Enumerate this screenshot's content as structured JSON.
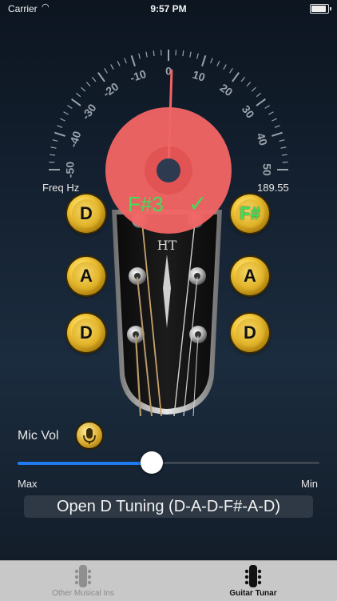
{
  "status_bar": {
    "carrier": "Carrier",
    "time": "9:57 PM"
  },
  "tuner": {
    "scale_labels": [
      "-50",
      "-40",
      "-30",
      "-20",
      "-10",
      "0",
      "10",
      "20",
      "30",
      "40",
      "50"
    ],
    "freq_label": "Freq Hz",
    "freq_value": "189.55",
    "detected_note": "F#3",
    "in_tune_mark": "✓",
    "needle_cents": 1,
    "colors": {
      "indicator": "#f06464",
      "note_text": "#3ee05a",
      "accent": "#1e7cf0"
    }
  },
  "headstock": {
    "brand_mark": "HT",
    "pegs_left": [
      "D",
      "A",
      "D"
    ],
    "pegs_right": [
      "F#",
      "A",
      "D"
    ],
    "active_peg": "F#"
  },
  "mic": {
    "label": "Mic Vol",
    "icon": "microphone-icon",
    "volume_fraction": 0.45,
    "max_label": "Max",
    "min_label": "Min"
  },
  "tuning": {
    "selected": "Open D Tuning (D-A-D-F#-A-D)"
  },
  "tabs": [
    {
      "label": "Other Musical Ins",
      "icon": "guitar-icon",
      "selected": false
    },
    {
      "label": "Guitar Tunar",
      "icon": "guitar-icon",
      "selected": true
    }
  ]
}
